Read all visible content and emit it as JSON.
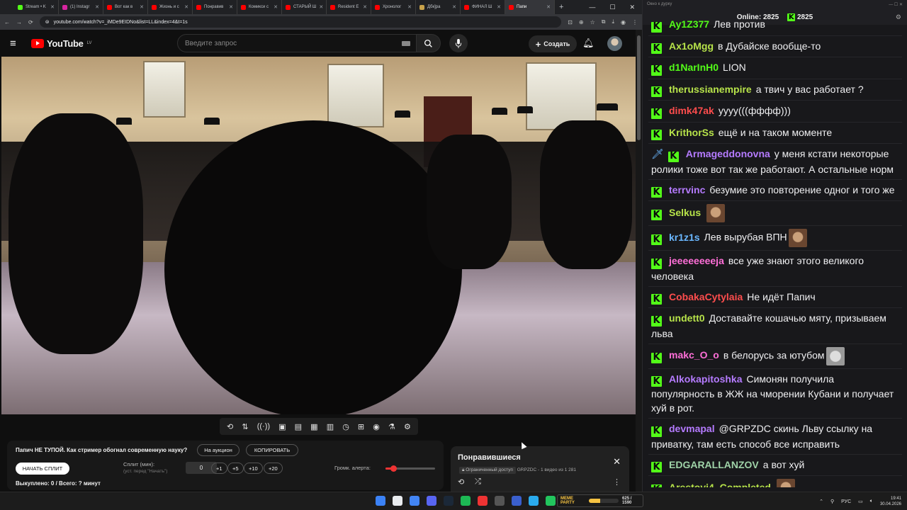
{
  "browser": {
    "tabs": [
      {
        "label": "Stream • K",
        "color": "#53fc18"
      },
      {
        "label": "(1) Instagr",
        "color": "#d6249f"
      },
      {
        "label": "Вот как в",
        "color": "#ff0000"
      },
      {
        "label": "Жизнь и с",
        "color": "#ff0000"
      },
      {
        "label": "Понравив",
        "color": "#ff0000"
      },
      {
        "label": "Комикси с",
        "color": "#ff0000"
      },
      {
        "label": "СТАРЫЙ Ш",
        "color": "#ff0000"
      },
      {
        "label": "Resident E",
        "color": "#ff0000"
      },
      {
        "label": "Хронолог",
        "color": "#ff0000"
      },
      {
        "label": "Дбк]ра",
        "color": "#c8a24a"
      },
      {
        "label": "ФИНАЛ Ш",
        "color": "#ff0000"
      },
      {
        "label": "Папи",
        "color": "#ff0000"
      }
    ],
    "url": "youtube.com/watch?v=_iMDe9EIDNo&list=LL&index=4&t=1s"
  },
  "youtube": {
    "logo_text": "YouTube",
    "region": "LV",
    "search_placeholder": "Введите запрос",
    "create_label": "Создать"
  },
  "controls": [
    "⟲",
    "⇅",
    "((·))",
    "▣",
    "▤",
    "▦",
    "▥",
    "◷",
    "⊞",
    "◉",
    "⚗",
    "⚙"
  ],
  "panel": {
    "title": "Папич НЕ ТУПОЙ. Как стример обогнал современную науку?",
    "auction_label": "На аукцион",
    "copy_label": "КОПИРОВАТЬ",
    "start_split_label": "НАЧАТЬ СПЛИТ",
    "split_label": "Сплит (мин):",
    "split_hint": "(уст. перед \"Начать\")",
    "split_value": "0",
    "plus_buttons": [
      "+1",
      "+5",
      "+10",
      "+20"
    ],
    "alert_label": "Громк. алерта:",
    "alert_volume": 0.15,
    "bought_text": "Выкуплено: 0 / Всего: ? минут"
  },
  "playlist": {
    "title": "Понравившиеся",
    "access": "Ограниченный доступ",
    "meta": "GRPZDC - 1 видео из 1 281"
  },
  "chat": {
    "window_title": "Окно к дурку",
    "online_label": "Online:",
    "online_count": "2825",
    "kick_count": "2825",
    "messages": [
      {
        "user": "Ay1Z377",
        "color": "#53fc18",
        "text": "Лев против",
        "cut": true
      },
      {
        "user": "Ax1oMgg",
        "color": "#b7e34a",
        "text": "в Дубайске вообще-то"
      },
      {
        "user": "d1NarInH0",
        "color": "#53fc18",
        "text": "LION"
      },
      {
        "user": "therussianempire",
        "color": "#b7e34a",
        "text": "а твич у вас работает ?"
      },
      {
        "user": "dimk47ak",
        "color": "#ff4d4d",
        "text": "уууу(((фффф)))"
      },
      {
        "user": "KrithorSs",
        "color": "#b7e34a",
        "text": "ещё и на таком моменте"
      },
      {
        "user": "Armageddonovna",
        "color": "#b57bff",
        "text": "у меня кстати некоторые ролики тоже вот так же работают. А остальные норм",
        "sword": true
      },
      {
        "user": "terrvinc",
        "color": "#b57bff",
        "text": "безумие это повторение одног и того же"
      },
      {
        "user": "Selkus",
        "color": "#b7e34a",
        "text": "",
        "emote": "face"
      },
      {
        "user": "kr1z1s",
        "color": "#6ab7ff",
        "text": "Лев вырубая ВПН",
        "emote": "face"
      },
      {
        "user": "jeeeeeeeeja",
        "color": "#ff6fd8",
        "text": "все уже знают этого великого человека"
      },
      {
        "user": "CobakaCytylaia",
        "color": "#ff4d4d",
        "text": "Не идёт Папич"
      },
      {
        "user": "undett0",
        "color": "#b7e34a",
        "text": "Доставайте кошачью мяту, призываем льва"
      },
      {
        "user": "makc_O_o",
        "color": "#ff6fd8",
        "text": "в белорусь за ютубом",
        "emote": "cat"
      },
      {
        "user": "Alkokapitoshka",
        "color": "#b57bff",
        "text": "Симонян получила популярность в ЖЖ на чморении Кубани и получает хуй в рот."
      },
      {
        "user": "devmapal",
        "color": "#b57bff",
        "text": "@GRPZDC скинь Льву ссылку на приватку, там есть способ все исправить"
      },
      {
        "user": "EDGARALLANZOV",
        "color": "#9fd3a8",
        "text": "а вот хуй"
      },
      {
        "user": "Arestovi4_Completed",
        "color": "#b7e34a",
        "text": "",
        "emote": "face"
      }
    ]
  },
  "taskbar": {
    "meme_label": "MEME PARTY",
    "meme_count": "625 / 1590",
    "meme_progress": 0.39,
    "lang": "РУС",
    "time": "19:41",
    "date": "30.04.2026"
  }
}
